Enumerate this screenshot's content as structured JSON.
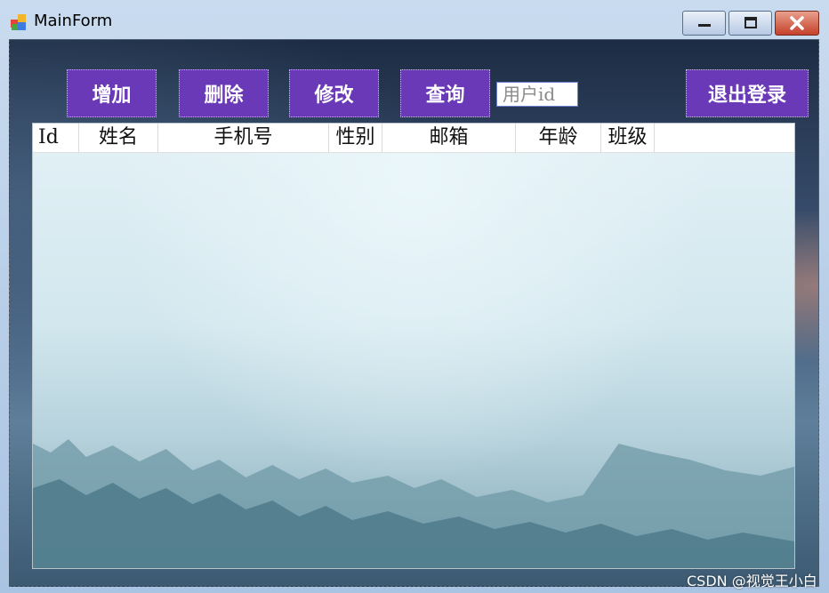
{
  "window": {
    "title": "MainForm",
    "icon": "windows-form-icon",
    "controls": [
      "minimize-icon",
      "maximize-icon",
      "close-icon"
    ]
  },
  "toolbar": {
    "add_label": "增加",
    "delete_label": "删除",
    "edit_label": "修改",
    "query_label": "查询",
    "search_placeholder": "用户id",
    "logout_label": "退出登录",
    "button_color": "#6a39b8"
  },
  "grid": {
    "columns": [
      "Id",
      "姓名",
      "手机号",
      "性别",
      "邮箱",
      "年龄",
      "班级"
    ],
    "rows": []
  },
  "watermark": "CSDN @视觉王小白"
}
